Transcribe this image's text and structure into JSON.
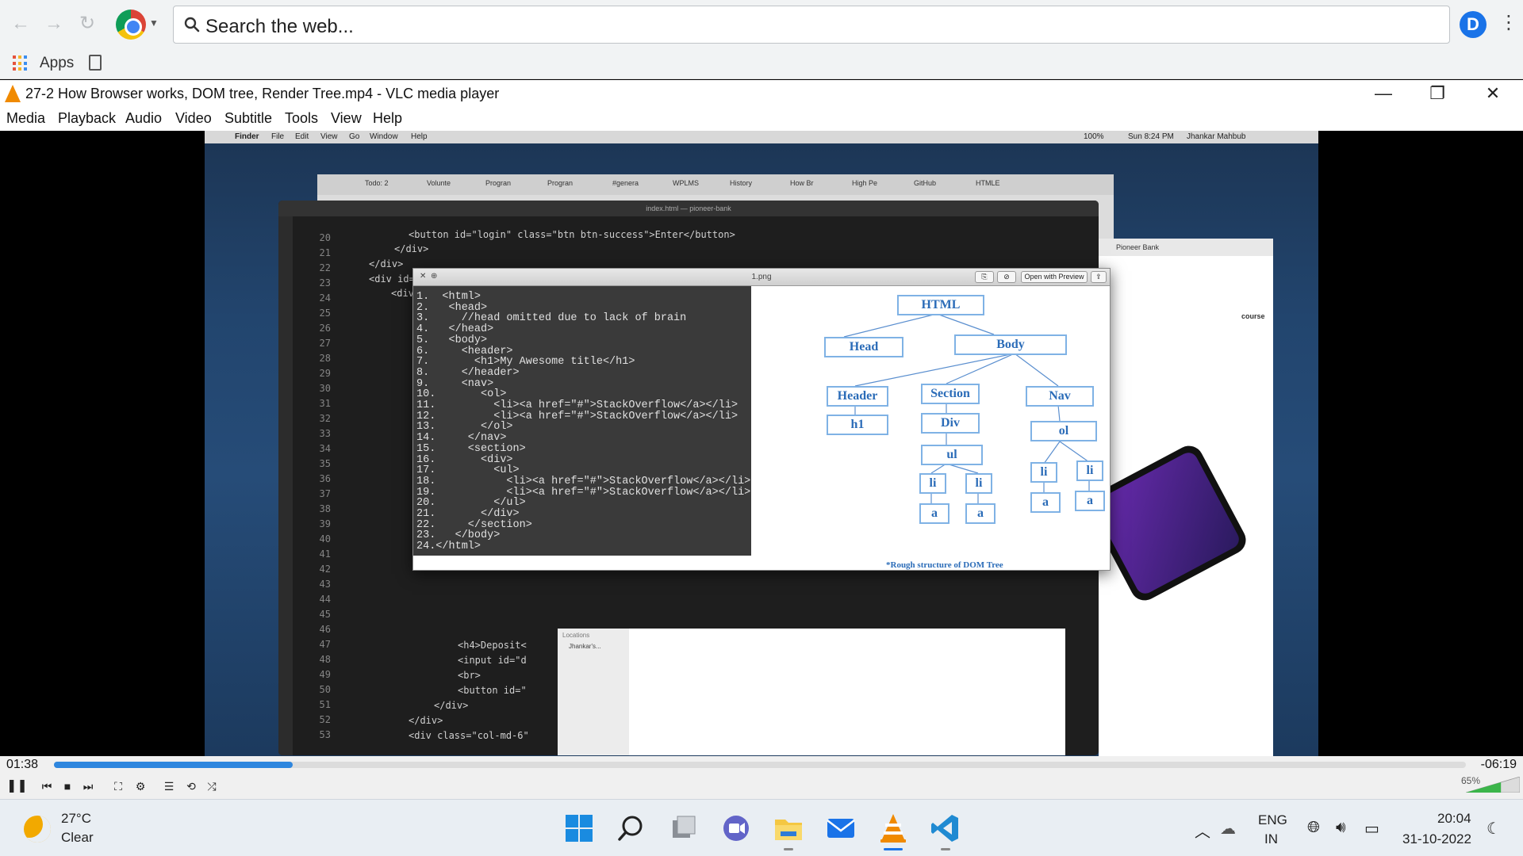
{
  "browser": {
    "omnibox_placeholder": "Search the web...",
    "profile_initial": "D",
    "bookmarks": {
      "apps_label": "Apps"
    }
  },
  "vlc": {
    "title": "27-2 How Browser works, DOM tree, Render Tree.mp4 - VLC media player",
    "menu": [
      "Media",
      "Playback",
      "Audio",
      "Video",
      "Subtitle",
      "Tools",
      "View",
      "Help"
    ],
    "time_elapsed": "01:38",
    "time_remaining": "-06:19",
    "progress_fraction": 0.169,
    "volume_label": "65%"
  },
  "mac": {
    "menubar": [
      "Finder",
      "File",
      "Edit",
      "View",
      "Go",
      "Window",
      "Help"
    ],
    "status": [
      "100%",
      "Sun 8:24 PM",
      "Jhankar Mahbub"
    ],
    "inner_tabs": [
      "Todo: 2",
      "Volunte",
      "Progran",
      "Progran",
      "#genera",
      "WPLMS",
      "History",
      "How Br",
      "High Pe",
      "GitHub",
      "HTMLE"
    ],
    "vscode_title": "index.html — pioneer-bank",
    "pioneer_tab": "Pioneer Bank",
    "pioneer_course": "course",
    "finder_locations": "Locations",
    "finder_item": "Jhankar's..."
  },
  "vscode": {
    "line_numbers": [
      "20",
      "21",
      "22",
      "23",
      "24",
      "25",
      "26",
      "27",
      "28",
      "29",
      "30",
      "31",
      "32",
      "33",
      "34",
      "35",
      "36",
      "37",
      "38",
      "39",
      "40",
      "41",
      "42",
      "43",
      "44",
      "45",
      "46",
      "47",
      "48",
      "49",
      "50",
      "51",
      "52",
      "53"
    ],
    "lines_top": [
      "<button id=\"login\" class=\"btn btn-success\">Enter</button>",
      "</div>",
      "</div>",
      "<div id=",
      "<div"
    ],
    "lines_bottom": [
      "<h4>Deposit<",
      "<input id=\"d",
      "<br>",
      "<button id=\"",
      "</div>",
      "</div>",
      "<div class=\"col-md-6\""
    ]
  },
  "viewer": {
    "title": "1.png",
    "open_with_preview": "Open with Preview",
    "code_lines": [
      "1.  <html>",
      "2.   <head>",
      "3.     //head omitted due to lack of brain",
      "4.   </head>",
      "5.   <body>",
      "6.     <header>",
      "7.       <h1>My Awesome title</h1>",
      "8.     </header>",
      "9.     <nav>",
      "10.       <ol>",
      "11.         <li><a href=\"#\">StackOverflow</a></li>",
      "12.         <li><a href=\"#\">StackOverflow</a></li>",
      "13.       </ol>",
      "14.     </nav>",
      "15.     <section>",
      "16.       <div>",
      "17.         <ul>",
      "18.           <li><a href=\"#\">StackOverflow</a></li>",
      "19.           <li><a href=\"#\">StackOverflow</a></li>",
      "20.         </ul>",
      "21.       </div>",
      "22.     </section>",
      "23.   </body>",
      "24.</html>"
    ],
    "tree": {
      "html": "HTML",
      "head": "Head",
      "body": "Body",
      "header": "Header",
      "h1": "h1",
      "section": "Section",
      "div": "Div",
      "ul": "ul",
      "li": "li",
      "a": "a",
      "nav": "Nav",
      "ol": "ol"
    },
    "caption": "*Rough structure of DOM Tree"
  },
  "taskbar": {
    "temp": "27°C",
    "condition": "Clear",
    "lang_1": "ENG",
    "lang_2": "IN",
    "time": "20:04",
    "date": "31-10-2022"
  },
  "colors": {
    "vlc_orange": "#f08a00",
    "seek_blue": "#2e86de",
    "tree_blue": "#2b6cb8"
  }
}
